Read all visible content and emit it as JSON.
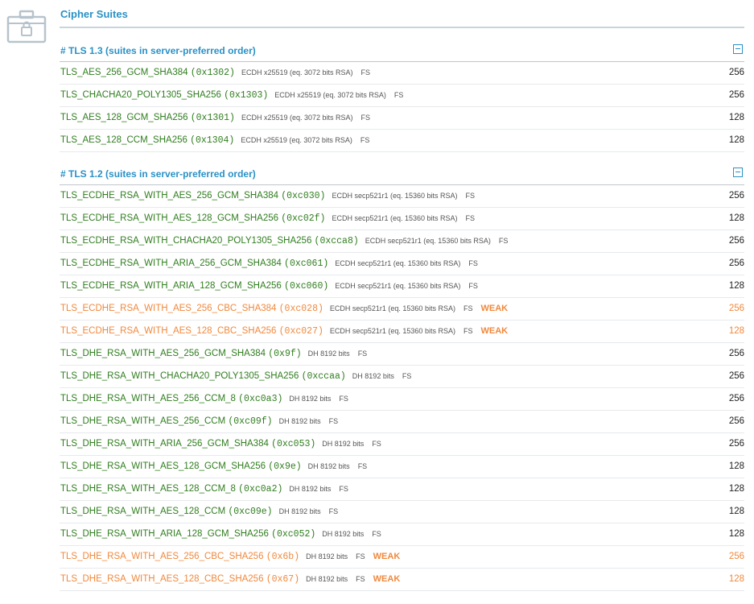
{
  "title": "Cipher Suites",
  "colors": {
    "accent": "#2a91c6",
    "strong": "#2f7d1e",
    "weak": "#f0883c"
  },
  "icons": {
    "header": "lock-case-icon",
    "collapse": "minus-box-icon"
  },
  "sections": [
    {
      "heading": "# TLS 1.3 (suites in server-preferred order)",
      "rows": [
        {
          "name": "TLS_AES_256_GCM_SHA384",
          "code": "(0x1302)",
          "kx": "ECDH x25519 (eq. 3072 bits RSA)",
          "fs": "FS",
          "weak": "",
          "bits": "256"
        },
        {
          "name": "TLS_CHACHA20_POLY1305_SHA256",
          "code": "(0x1303)",
          "kx": "ECDH x25519 (eq. 3072 bits RSA)",
          "fs": "FS",
          "weak": "",
          "bits": "256"
        },
        {
          "name": "TLS_AES_128_GCM_SHA256",
          "code": "(0x1301)",
          "kx": "ECDH x25519 (eq. 3072 bits RSA)",
          "fs": "FS",
          "weak": "",
          "bits": "128"
        },
        {
          "name": "TLS_AES_128_CCM_SHA256",
          "code": "(0x1304)",
          "kx": "ECDH x25519 (eq. 3072 bits RSA)",
          "fs": "FS",
          "weak": "",
          "bits": "128"
        }
      ]
    },
    {
      "heading": "# TLS 1.2 (suites in server-preferred order)",
      "rows": [
        {
          "name": "TLS_ECDHE_RSA_WITH_AES_256_GCM_SHA384",
          "code": "(0xc030)",
          "kx": "ECDH secp521r1 (eq. 15360 bits RSA)",
          "fs": "FS",
          "weak": "",
          "bits": "256"
        },
        {
          "name": "TLS_ECDHE_RSA_WITH_AES_128_GCM_SHA256",
          "code": "(0xc02f)",
          "kx": "ECDH secp521r1 (eq. 15360 bits RSA)",
          "fs": "FS",
          "weak": "",
          "bits": "128"
        },
        {
          "name": "TLS_ECDHE_RSA_WITH_CHACHA20_POLY1305_SHA256",
          "code": "(0xcca8)",
          "kx": "ECDH secp521r1 (eq. 15360 bits RSA)",
          "fs": "FS",
          "weak": "",
          "bits": "256"
        },
        {
          "name": "TLS_ECDHE_RSA_WITH_ARIA_256_GCM_SHA384",
          "code": "(0xc061)",
          "kx": "ECDH secp521r1 (eq. 15360 bits RSA)",
          "fs": "FS",
          "weak": "",
          "bits": "256"
        },
        {
          "name": "TLS_ECDHE_RSA_WITH_ARIA_128_GCM_SHA256",
          "code": "(0xc060)",
          "kx": "ECDH secp521r1 (eq. 15360 bits RSA)",
          "fs": "FS",
          "weak": "",
          "bits": "128"
        },
        {
          "name": "TLS_ECDHE_RSA_WITH_AES_256_CBC_SHA384",
          "code": "(0xc028)",
          "kx": "ECDH secp521r1 (eq. 15360 bits RSA)",
          "fs": "FS",
          "weak": "WEAK",
          "bits": "256"
        },
        {
          "name": "TLS_ECDHE_RSA_WITH_AES_128_CBC_SHA256",
          "code": "(0xc027)",
          "kx": "ECDH secp521r1 (eq. 15360 bits RSA)",
          "fs": "FS",
          "weak": "WEAK",
          "bits": "128"
        },
        {
          "name": "TLS_DHE_RSA_WITH_AES_256_GCM_SHA384",
          "code": "(0x9f)",
          "kx": "DH 8192 bits",
          "fs": "FS",
          "weak": "",
          "bits": "256"
        },
        {
          "name": "TLS_DHE_RSA_WITH_CHACHA20_POLY1305_SHA256",
          "code": "(0xccaa)",
          "kx": "DH 8192 bits",
          "fs": "FS",
          "weak": "",
          "bits": "256"
        },
        {
          "name": "TLS_DHE_RSA_WITH_AES_256_CCM_8",
          "code": "(0xc0a3)",
          "kx": "DH 8192 bits",
          "fs": "FS",
          "weak": "",
          "bits": "256"
        },
        {
          "name": "TLS_DHE_RSA_WITH_AES_256_CCM",
          "code": "(0xc09f)",
          "kx": "DH 8192 bits",
          "fs": "FS",
          "weak": "",
          "bits": "256"
        },
        {
          "name": "TLS_DHE_RSA_WITH_ARIA_256_GCM_SHA384",
          "code": "(0xc053)",
          "kx": "DH 8192 bits",
          "fs": "FS",
          "weak": "",
          "bits": "256"
        },
        {
          "name": "TLS_DHE_RSA_WITH_AES_128_GCM_SHA256",
          "code": "(0x9e)",
          "kx": "DH 8192 bits",
          "fs": "FS",
          "weak": "",
          "bits": "128"
        },
        {
          "name": "TLS_DHE_RSA_WITH_AES_128_CCM_8",
          "code": "(0xc0a2)",
          "kx": "DH 8192 bits",
          "fs": "FS",
          "weak": "",
          "bits": "128"
        },
        {
          "name": "TLS_DHE_RSA_WITH_AES_128_CCM",
          "code": "(0xc09e)",
          "kx": "DH 8192 bits",
          "fs": "FS",
          "weak": "",
          "bits": "128"
        },
        {
          "name": "TLS_DHE_RSA_WITH_ARIA_128_GCM_SHA256",
          "code": "(0xc052)",
          "kx": "DH 8192 bits",
          "fs": "FS",
          "weak": "",
          "bits": "128"
        },
        {
          "name": "TLS_DHE_RSA_WITH_AES_256_CBC_SHA256",
          "code": "(0x6b)",
          "kx": "DH 8192 bits",
          "fs": "FS",
          "weak": "WEAK",
          "bits": "256"
        },
        {
          "name": "TLS_DHE_RSA_WITH_AES_128_CBC_SHA256",
          "code": "(0x67)",
          "kx": "DH 8192 bits",
          "fs": "FS",
          "weak": "WEAK",
          "bits": "128"
        }
      ]
    }
  ]
}
